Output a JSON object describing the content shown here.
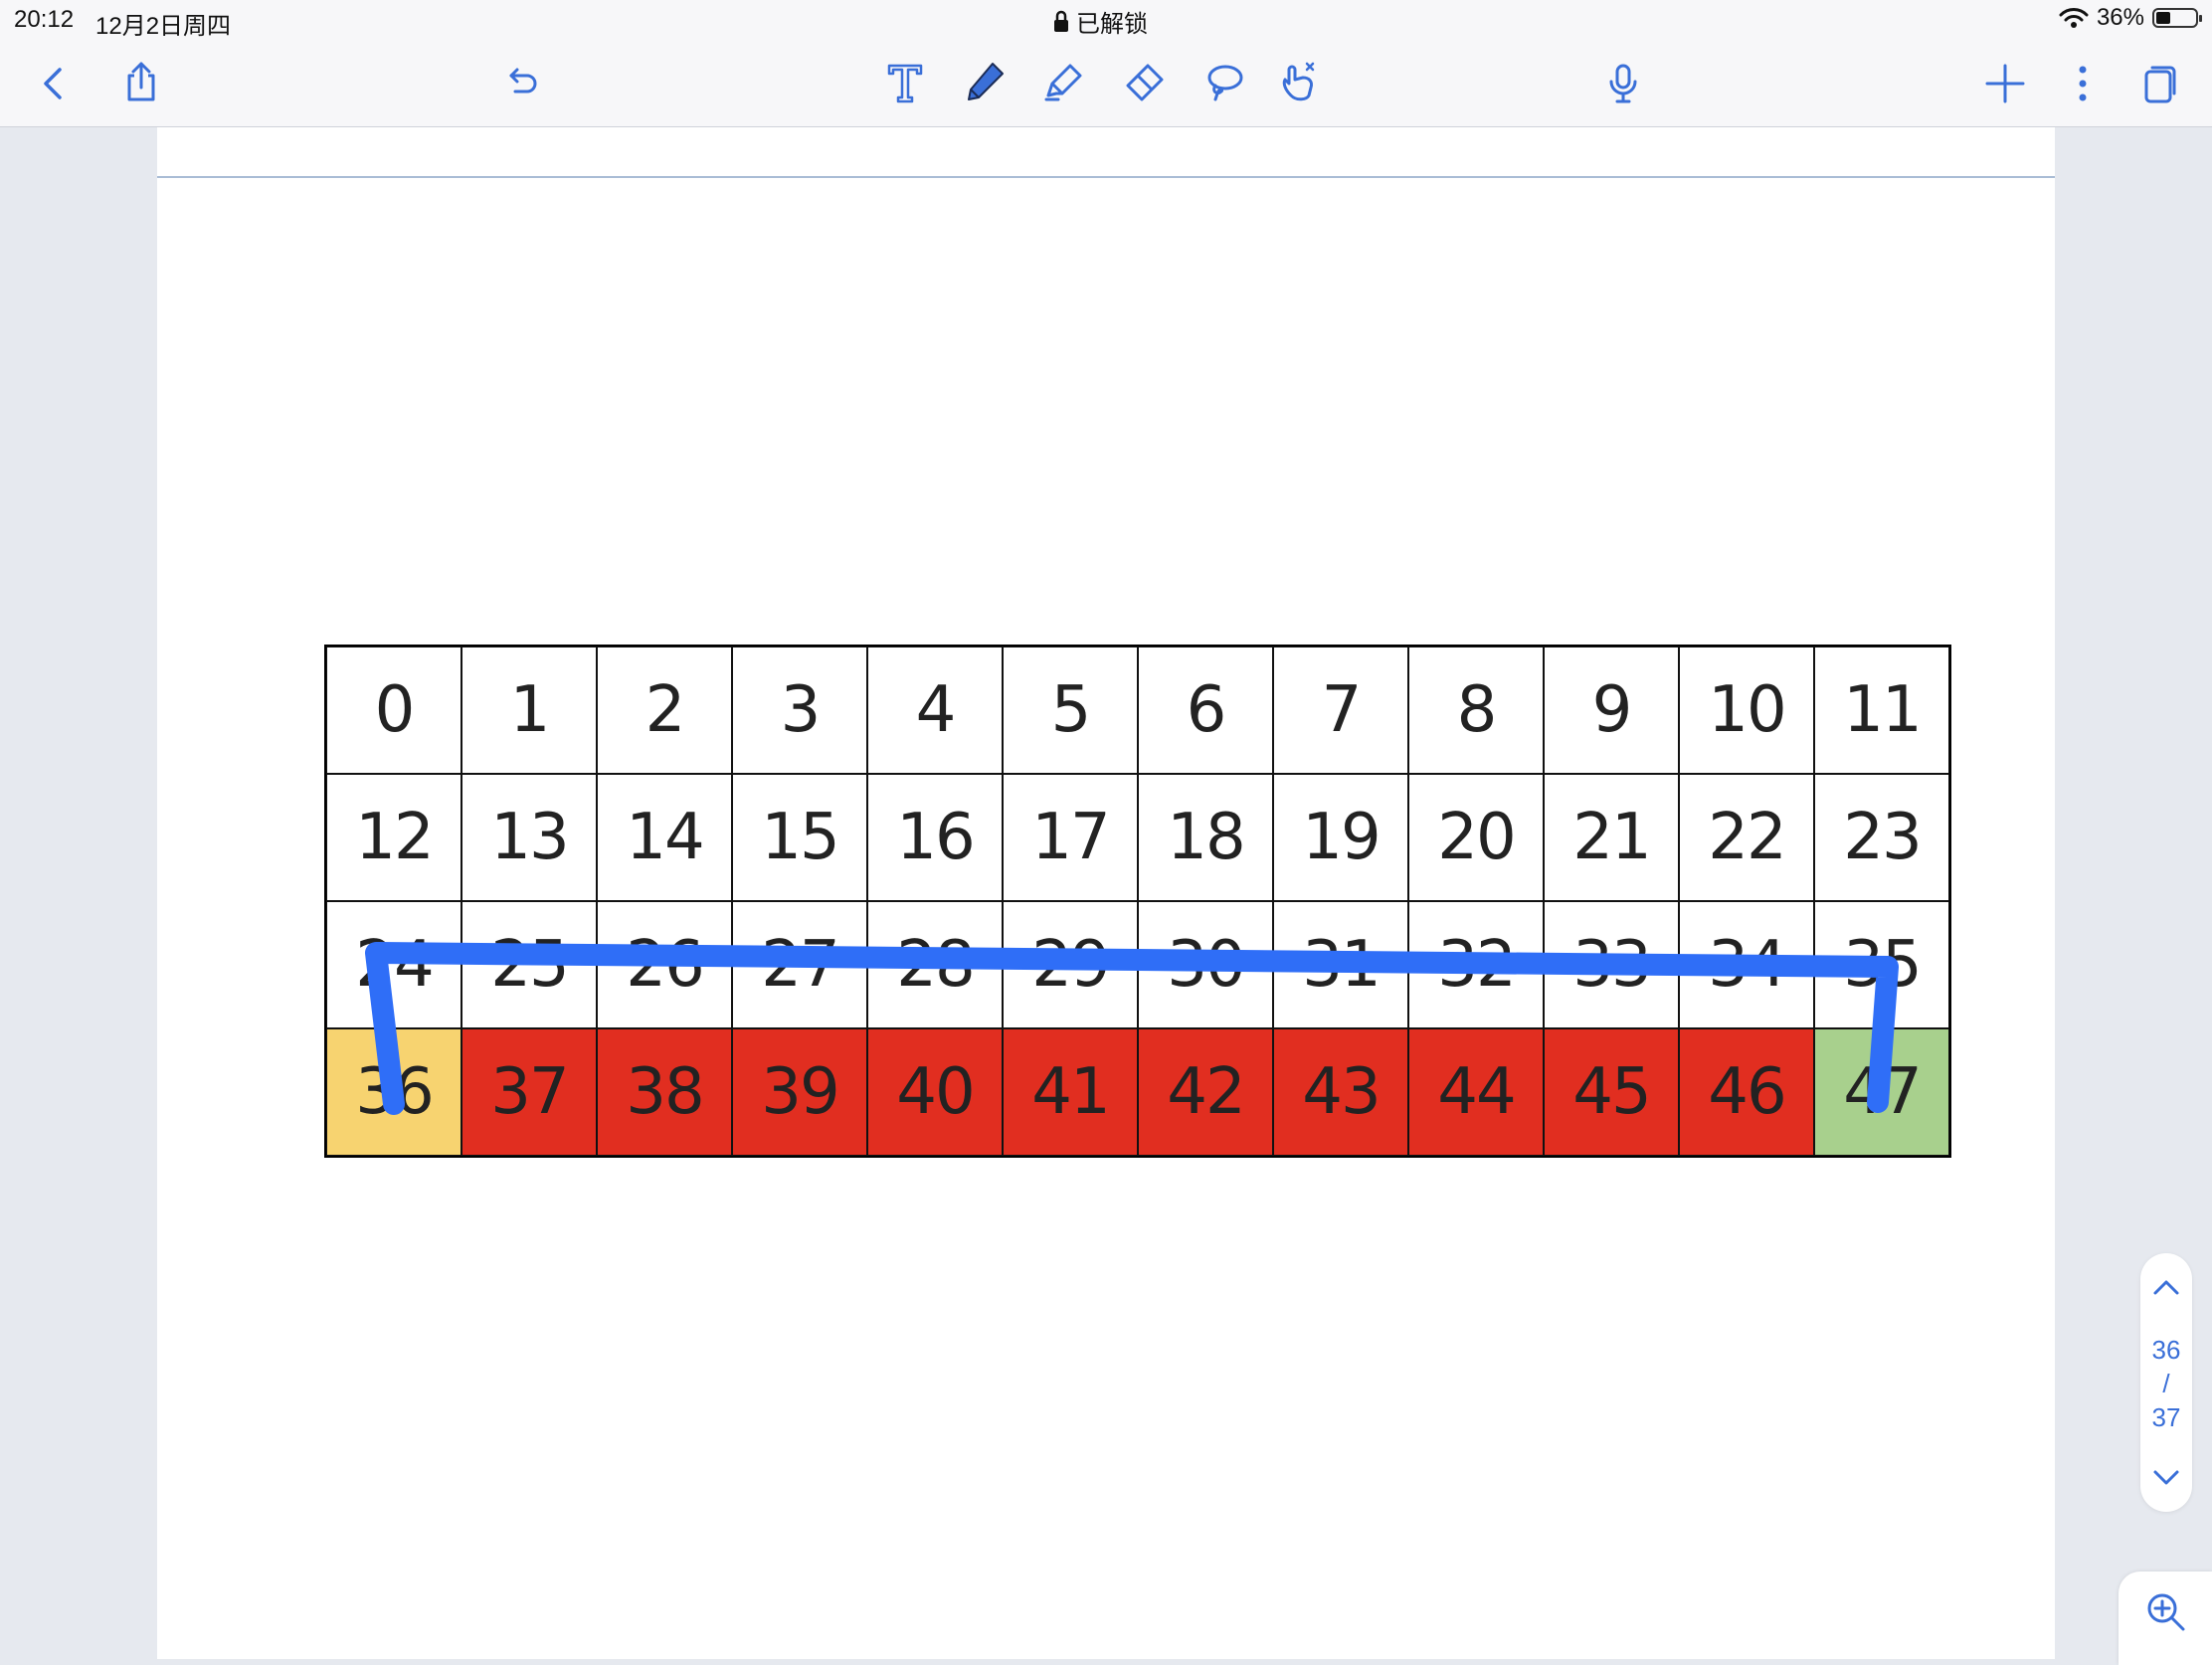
{
  "status": {
    "time": "20:12",
    "date": "12月2日周四",
    "lock_text": "已解锁",
    "battery": "36%",
    "battery_level": 0.36
  },
  "toolbar": {
    "left": [
      "back-icon",
      "share-icon",
      "undo-icon"
    ],
    "tools": [
      "text-tool-icon",
      "pen-icon",
      "highlighter-icon",
      "eraser-icon",
      "lasso-icon",
      "hand-pointer-icon"
    ],
    "right": [
      "microphone-icon",
      "plus-icon",
      "more-icon",
      "pages-icon"
    ],
    "accent_color": "#3a6fd8"
  },
  "grid": {
    "rows": [
      [
        "0",
        "1",
        "2",
        "3",
        "4",
        "5",
        "6",
        "7",
        "8",
        "9",
        "10",
        "11"
      ],
      [
        "12",
        "13",
        "14",
        "15",
        "16",
        "17",
        "18",
        "19",
        "20",
        "21",
        "22",
        "23"
      ],
      [
        "24",
        "25",
        "26",
        "27",
        "28",
        "29",
        "30",
        "31",
        "32",
        "33",
        "34",
        "35"
      ],
      [
        "36",
        "37",
        "38",
        "39",
        "40",
        "41",
        "42",
        "43",
        "44",
        "45",
        "46",
        "47"
      ]
    ],
    "highlight": {
      "yellow": [
        "36"
      ],
      "red": [
        "37",
        "38",
        "39",
        "40",
        "41",
        "42",
        "43",
        "44",
        "45",
        "46"
      ],
      "green": [
        "47"
      ]
    },
    "colors": {
      "red": "#e12e20",
      "yellow": "#f7d370",
      "green": "#a8d08d",
      "ink": "#2f6ef7"
    }
  },
  "pager": {
    "current": "36",
    "separator": "/",
    "total": "37"
  }
}
